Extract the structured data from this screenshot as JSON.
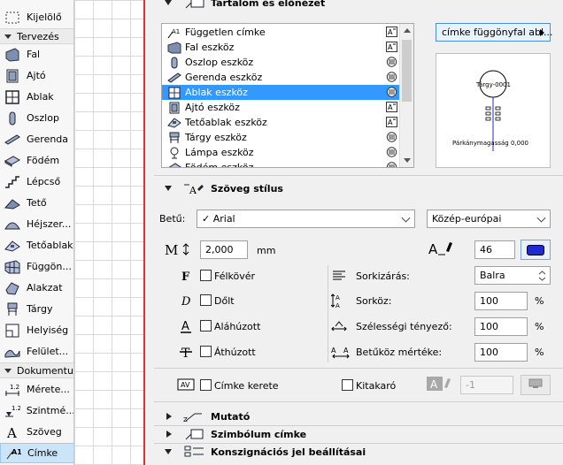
{
  "toolbox": {
    "selection_item": {
      "label": "Kijelölő",
      "icon": "dashed-select-icon"
    },
    "groups": [
      {
        "label": "Tervezés",
        "items": [
          {
            "label": "Fal",
            "icon": "wall-icon"
          },
          {
            "label": "Ajtó",
            "icon": "door-icon"
          },
          {
            "label": "Ablak",
            "icon": "window-icon"
          },
          {
            "label": "Oszlop",
            "icon": "column-icon"
          },
          {
            "label": "Gerenda",
            "icon": "beam-icon"
          },
          {
            "label": "Födém",
            "icon": "slab-icon"
          },
          {
            "label": "Lépcső",
            "icon": "stair-icon"
          },
          {
            "label": "Tető",
            "icon": "roof-icon"
          },
          {
            "label": "Héjszer...",
            "icon": "shell-icon"
          },
          {
            "label": "Tetőablak",
            "icon": "skylight-icon"
          },
          {
            "label": "Függön...",
            "icon": "curtain-wall-icon"
          },
          {
            "label": "Alakzat",
            "icon": "morph-icon"
          },
          {
            "label": "Tárgy",
            "icon": "object-icon"
          },
          {
            "label": "Helyiség",
            "icon": "zone-icon"
          },
          {
            "label": "Felület...",
            "icon": "mesh-icon"
          }
        ]
      },
      {
        "label": "Dokumentum",
        "items": [
          {
            "label": "Mérete...",
            "icon": "dimension-icon"
          },
          {
            "label": "Szintmé...",
            "icon": "level-dimension-icon"
          },
          {
            "label": "Szöveg",
            "icon": "text-icon"
          },
          {
            "label": "Címke",
            "icon": "label-icon",
            "active": true
          }
        ]
      }
    ]
  },
  "dialog": {
    "sections": {
      "content_preview": "Tartalom és előnézet",
      "text_style": "Szöveg stílus",
      "pointer": "Mutató",
      "symbol_label": "Szimbólum címke",
      "consignment": "Konszignációs jel beállításai"
    },
    "tool_list": [
      {
        "label": "Független címke",
        "icon": "independent-label-icon",
        "mode": "text-label-icon"
      },
      {
        "label": "Fal eszköz",
        "icon": "wall-icon",
        "mode": "text-label-icon"
      },
      {
        "label": "Oszlop eszköz",
        "icon": "column-icon",
        "mode": "symbol-label-icon"
      },
      {
        "label": "Gerenda eszköz",
        "icon": "beam-icon",
        "mode": "symbol-label-icon"
      },
      {
        "label": "Ablak eszköz",
        "icon": "window-icon",
        "mode": "symbol-label-icon",
        "selected": true
      },
      {
        "label": "Ajtó eszköz",
        "icon": "door-icon",
        "mode": "text-label-icon"
      },
      {
        "label": "Tetőablak eszköz",
        "icon": "skylight-icon",
        "mode": "text-label-icon"
      },
      {
        "label": "Tárgy eszköz",
        "icon": "object-icon",
        "mode": "symbol-label-icon"
      },
      {
        "label": "Lámpa eszköz",
        "icon": "lamp-icon",
        "mode": "symbol-label-icon"
      },
      {
        "label": "Födém eszköz",
        "icon": "slab-icon",
        "mode": "symbol-label-icon"
      }
    ],
    "label_type_button": "címke függönyfal abl...",
    "preview": {
      "object_text": "Tárgy-0001",
      "sill_text": "Párkánymagasság 0,000"
    },
    "font_label": "Betű:",
    "font_value": "✓ Arial",
    "encoding_value": "Közép-európai",
    "text_size": "2,000",
    "text_size_unit": "mm",
    "pen_number": "46",
    "pen_color": "#1e2bd0",
    "styles": {
      "bold": "Félkövér",
      "italic": "Dőlt",
      "underline": "Aláhúzott",
      "strikethrough": "Áthúzott"
    },
    "justification_label": "Sorkizárás:",
    "justification_value": "Balra",
    "line_spacing_label": "Sorköz:",
    "line_spacing_value": "100",
    "width_factor_label": "Szélességi tényező:",
    "width_factor_value": "100",
    "char_spacing_label": "Betűköz mértéke:",
    "char_spacing_value": "100",
    "percent": "%",
    "label_frame": "Címke kerete",
    "opaque": "Kitakaró",
    "fill_pen": "-1"
  }
}
